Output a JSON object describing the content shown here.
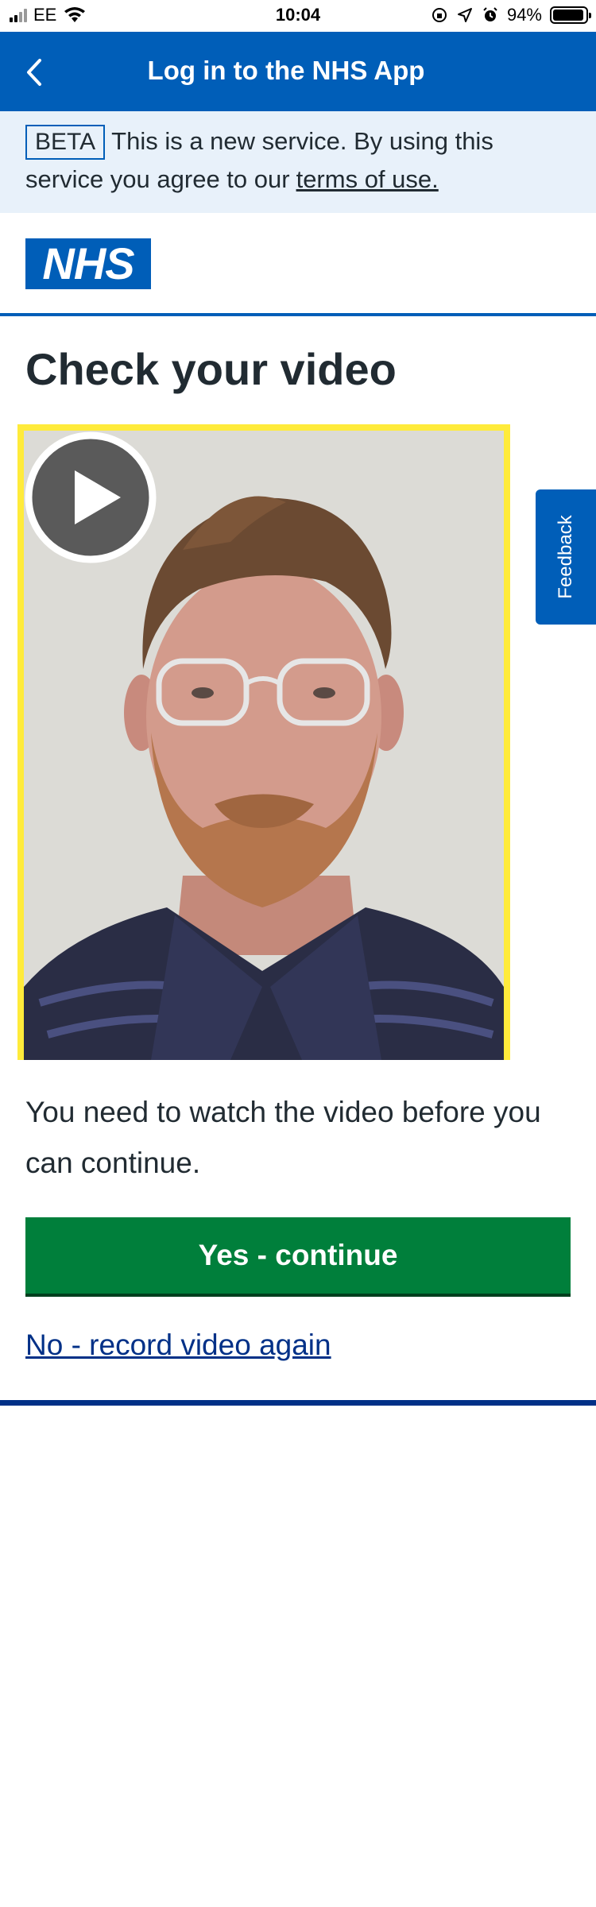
{
  "status_bar": {
    "carrier": "EE",
    "time": "10:04",
    "battery": "94%",
    "battery_level": 0.94
  },
  "header": {
    "title": "Log in to the NHS App",
    "back_icon": "chevron-left-icon"
  },
  "beta_banner": {
    "tag": "BETA",
    "text": "This is a new service. By using this service you agree to our",
    "link": "terms of use."
  },
  "logo": {
    "text": "NHS"
  },
  "main": {
    "title": "Check your video",
    "instruction": "You need to watch the video before you can continue.",
    "continue_label": "Yes - continue",
    "record_again_label": "No - record video again"
  },
  "feedback": {
    "label": "Feedback"
  },
  "colors": {
    "nhs_blue": "#005eb8",
    "dark_blue": "#003087",
    "green": "#007f3b",
    "focus_yellow": "#ffeb3b",
    "banner_bg": "#e8f1fa"
  }
}
